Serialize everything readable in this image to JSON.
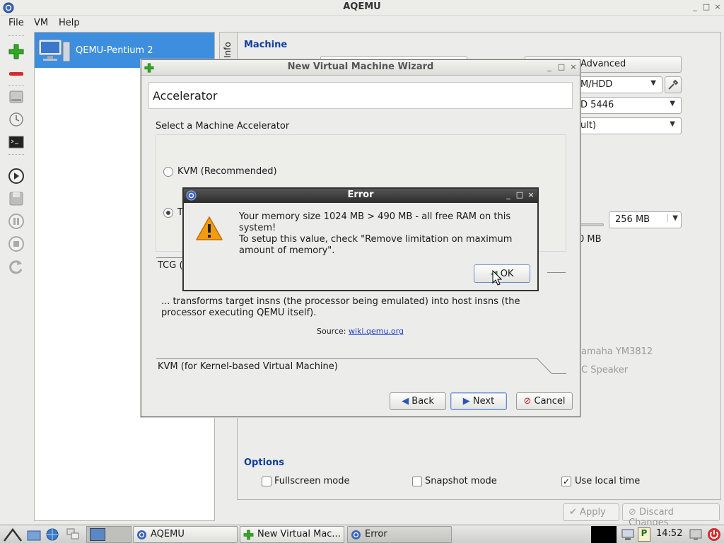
{
  "window": {
    "title": "AQEMU"
  },
  "menubar": {
    "items": [
      {
        "label": "File"
      },
      {
        "label": "VM"
      },
      {
        "label": "Help"
      }
    ]
  },
  "vm_list": {
    "items": [
      {
        "label": "QEMU-Pentium 2",
        "selected": true
      }
    ]
  },
  "info_tab": {
    "label": "Info"
  },
  "right_panel": {
    "machine_title": "Machine",
    "advanced_label": "Advanced",
    "boot_partial": "M/HDD",
    "video_partial": "D 5446",
    "network_partial": "ult)",
    "memory_value": "256 MB",
    "free_mem_partial": "0 MB",
    "sound_partial_1": "amaha YM3812",
    "sound_partial_2": "C Speaker",
    "options_title": "Options",
    "options": [
      {
        "label": "Fullscreen mode",
        "checked": false
      },
      {
        "label": "Snapshot mode",
        "checked": false
      },
      {
        "label": "Use local time",
        "checked": true
      }
    ],
    "apply_label": "Apply",
    "discard_label": "Discard Changes"
  },
  "wizard": {
    "title": "New Virtual Machine Wizard",
    "page_title": "Accelerator",
    "prompt": "Select a Machine Accelerator",
    "kvm_label": "KVM (Recommended)",
    "tcg_partial": "T",
    "tcg_section": "TCG (",
    "tcg_description": "... transforms target insns (the processor being emulated) into host insns (the processor executing QEMU itself).",
    "source_label": "Source:",
    "source_link": "wiki.qemu.org",
    "kvm_section": "KVM (for Kernel-based Virtual Machine)",
    "back_label": "Back",
    "next_label": "Next",
    "cancel_label": "Cancel"
  },
  "error_dialog": {
    "title": "Error",
    "message_line1": "Your memory size 1024 MB > 490 MB - all free RAM on this",
    "message_line2": "system!",
    "message_line3": "To setup this value, check \"Remove limitation on maximum",
    "message_line4": "amount of memory\".",
    "ok_label": "OK"
  },
  "taskbar": {
    "tasks": [
      {
        "label": "AQEMU"
      },
      {
        "label": "New Virtual Mac..."
      },
      {
        "label": "Error"
      }
    ],
    "clock": "14:52"
  },
  "colors": {
    "accent": "#3d8ede",
    "section_title": "#0f3e9e",
    "link": "#1f3fbf"
  }
}
